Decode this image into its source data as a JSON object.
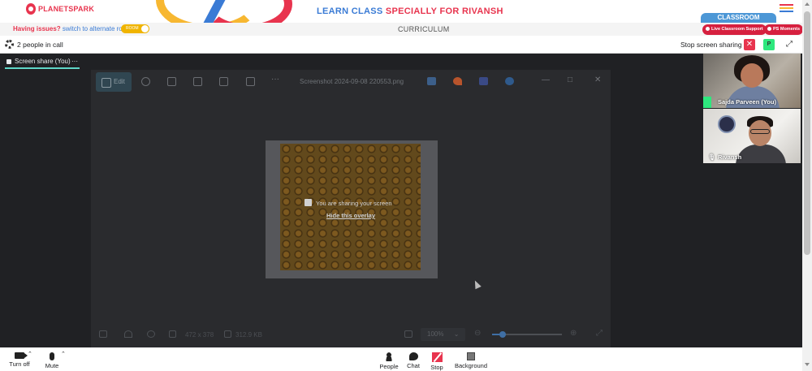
{
  "header": {
    "logo_text": "PLANETSPARK",
    "title_part1": "LEARN CLASS ",
    "title_part2": "SPECIALLY FOR RIVANSH",
    "classroom_tab": "CLASSROOM",
    "menu_colors": [
      "#e8344e",
      "#f7b731",
      "#3a7bd5"
    ]
  },
  "subbar": {
    "issue_text": "Having issues?",
    "switch_text": " switch to alternate room",
    "toggle_label": "ROOM",
    "curriculum": "CURRICULUM",
    "support_pill": "Live Classroom Support",
    "moments_pill": "PS Moments"
  },
  "call": {
    "people_count": "2 people in call",
    "stop_share_label": "Stop screen sharing",
    "stop_icon": "✕",
    "avatar_initial": "P",
    "expand_icon": "⤢"
  },
  "stage": {
    "share_tab_label": "Screen share (You)",
    "share_tab_more": "···"
  },
  "viewer": {
    "edit_label": "Edit",
    "more_dots": "···",
    "filename": "Screenshot 2024-09-08 220553.png",
    "minimize": "—",
    "maximize": "□",
    "close": "✕",
    "dimensions": "472 x 378",
    "filesize": "312.9 KB",
    "zoom_value": "100%",
    "zoom_caret": "⌄",
    "zoom_out": "⊖",
    "zoom_in": "⊕",
    "fullscreen": "⤢",
    "zoom_level": 0.15
  },
  "overlay": {
    "sharing_text": "You are sharing your screen",
    "hide_link": "Hide this overlay"
  },
  "participants": [
    {
      "name": "Sajda Parveen (You)"
    },
    {
      "name": "Rivansh"
    }
  ],
  "controls": {
    "camera": "Turn off",
    "mic": "Mute",
    "people": "People",
    "chat": "Chat",
    "stop": "Stop",
    "background": "Background",
    "caret": "⌃"
  },
  "colors": {
    "brand_red": "#e8344e",
    "brand_blue": "#3a7bd5",
    "brand_yellow": "#f7b731",
    "stage_bg": "#202124",
    "active_tab": "#5fd6c7"
  }
}
